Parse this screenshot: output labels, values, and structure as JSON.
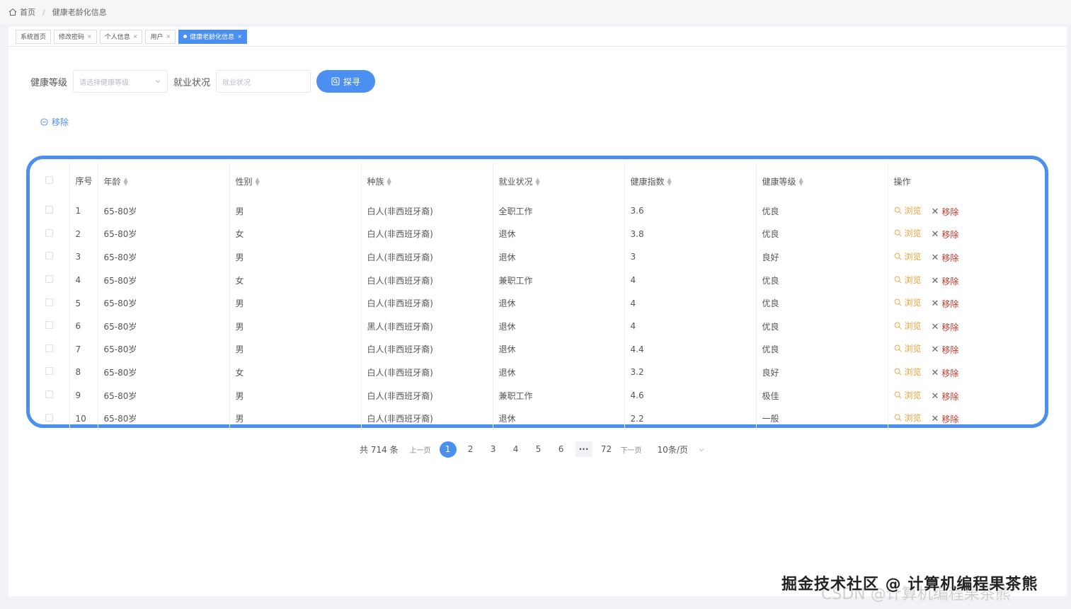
{
  "breadcrumb": {
    "home": "首页",
    "current": "健康老龄化信息"
  },
  "tags": [
    {
      "label": "系统首页",
      "closable": false,
      "active": false
    },
    {
      "label": "修改密码",
      "closable": true,
      "active": false
    },
    {
      "label": "个人信息",
      "closable": true,
      "active": false
    },
    {
      "label": "用户",
      "closable": true,
      "active": false
    },
    {
      "label": "健康老龄化信息",
      "closable": true,
      "active": true
    }
  ],
  "search": {
    "health_level_label": "健康等级",
    "health_level_placeholder": "请选择健康等级",
    "employment_label": "就业状况",
    "employment_placeholder": "就业状况",
    "search_button": "探寻"
  },
  "toolbar": {
    "remove_label": "移除"
  },
  "table": {
    "columns": [
      "序号",
      "年龄",
      "性别",
      "种族",
      "就业状况",
      "健康指数",
      "健康等级",
      "操作"
    ],
    "view_label": "浏览",
    "remove_label": "移除",
    "rows": [
      [
        "1",
        "65-80岁",
        "男",
        "白人(非西班牙裔)",
        "全职工作",
        "3.6",
        "优良"
      ],
      [
        "2",
        "65-80岁",
        "女",
        "白人(非西班牙裔)",
        "退休",
        "3.8",
        "优良"
      ],
      [
        "3",
        "65-80岁",
        "男",
        "白人(非西班牙裔)",
        "退休",
        "3",
        "良好"
      ],
      [
        "4",
        "65-80岁",
        "女",
        "白人(非西班牙裔)",
        "兼职工作",
        "4",
        "优良"
      ],
      [
        "5",
        "65-80岁",
        "男",
        "白人(非西班牙裔)",
        "退休",
        "4",
        "优良"
      ],
      [
        "6",
        "65-80岁",
        "男",
        "黑人(非西班牙裔)",
        "退休",
        "4",
        "优良"
      ],
      [
        "7",
        "65-80岁",
        "男",
        "白人(非西班牙裔)",
        "退休",
        "4.4",
        "优良"
      ],
      [
        "8",
        "65-80岁",
        "女",
        "白人(非西班牙裔)",
        "退休",
        "3.2",
        "良好"
      ],
      [
        "9",
        "65-80岁",
        "男",
        "白人(非西班牙裔)",
        "兼职工作",
        "4.6",
        "极佳"
      ],
      [
        "10",
        "65-80岁",
        "男",
        "白人(非西班牙裔)",
        "退休",
        "2.2",
        "一般"
      ]
    ]
  },
  "pagination": {
    "total": "共 714 条",
    "prev": "上一页",
    "pages": [
      "1",
      "2",
      "3",
      "4",
      "5",
      "6",
      "···",
      "72"
    ],
    "current": "1",
    "next": "下一页",
    "page_size": "10条/页"
  },
  "watermark": "掘金技术社区 @ 计算机编程果茶熊",
  "watermark2": "CSDN @计算机编程果茶熊",
  "colors": {
    "accent": "#4b8ff0",
    "view": "#e6a23c",
    "remove": "#c0392b"
  }
}
